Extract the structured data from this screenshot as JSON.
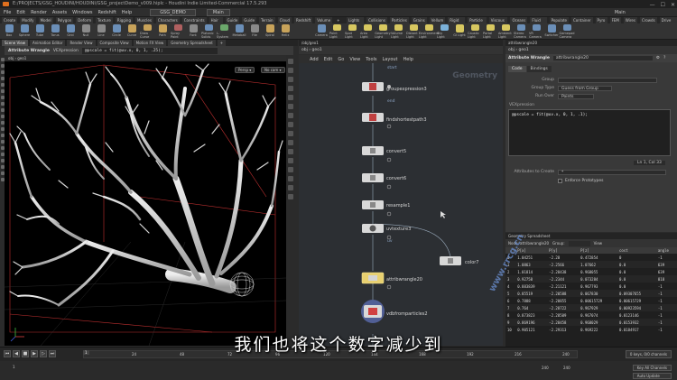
{
  "window": {
    "title": "E:/PROJECTS/GSG_HOUDINI/HOUDINI/GSG_projectDemo_v009.hiplc - Houdini Indie Limited-Commercial 17.5.293",
    "controls": [
      "—",
      "☐",
      "✕"
    ]
  },
  "menubar": {
    "items": [
      "File",
      "Edit",
      "Render",
      "Assets",
      "Windows",
      "Redshift",
      "Help"
    ],
    "desktop": "GSG_DEMO",
    "build": "Main",
    "right_label": "Main"
  },
  "shelf_tabs": [
    "Create",
    "Modify",
    "Model",
    "Polygon",
    "Deform",
    "Texture",
    "Rigging",
    "Muscles",
    "Characters",
    "Constraints",
    "Hair Utils",
    "Guide Pr",
    "Guide Br",
    "Terrain FX",
    "Cloud FX",
    "Redshift",
    "Volume",
    "+",
    "Lights and C",
    "Collisions",
    "Particles",
    "Grains",
    "Vellum",
    "Rigid Bodies",
    "Particle Fluids",
    "Viscous Fluids",
    "Oceans",
    "Fluid Contai",
    "Populate Con",
    "Container Tools",
    "Pyro FX",
    "FEM",
    "Wires",
    "Crowds",
    "Drive Simula"
  ],
  "shelf_tools_left": [
    {
      "label": "Box",
      "color": "#6b8fb8"
    },
    {
      "label": "Sphere",
      "color": "#6b8fb8"
    },
    {
      "label": "Tube",
      "color": "#6b8fb8"
    },
    {
      "label": "Torus",
      "color": "#6b8fb8"
    },
    {
      "label": "Grid",
      "color": "#6b8fb8"
    },
    {
      "label": "Null",
      "color": "#8a8a8a"
    },
    {
      "label": "Line",
      "color": "#8a8a8a"
    },
    {
      "label": "Circle",
      "color": "#6b8fb8"
    },
    {
      "label": "Curve",
      "color": "#c8a35a"
    },
    {
      "label": "Draw Curve",
      "color": "#c8a35a"
    },
    {
      "label": "Path",
      "color": "#c8a35a"
    },
    {
      "label": "Spray Paint",
      "color": "#b06060"
    },
    {
      "label": "Font",
      "color": "#8a8a8a"
    },
    {
      "label": "Platonic Solids",
      "color": "#6b8fb8"
    },
    {
      "label": "L-System",
      "color": "#6ba86b"
    },
    {
      "label": "Metaball",
      "color": "#6b8fb8"
    },
    {
      "label": "File",
      "color": "#8a8a8a"
    },
    {
      "label": "Spiral",
      "color": "#c8a35a"
    },
    {
      "label": "Helix",
      "color": "#c8a35a"
    }
  ],
  "shelf_tools_right": [
    {
      "label": "Camera",
      "color": "#6b8fb8"
    },
    {
      "label": "Point Light",
      "color": "#d8c860"
    },
    {
      "label": "Spot Light",
      "color": "#d8c860"
    },
    {
      "label": "Area Light",
      "color": "#d8c860"
    },
    {
      "label": "Geometry Light",
      "color": "#d8c860"
    },
    {
      "label": "Volume Light",
      "color": "#d8c860"
    },
    {
      "label": "Distant Light",
      "color": "#d8c860"
    },
    {
      "label": "Environment Light",
      "color": "#d8c860"
    },
    {
      "label": "Sky Light",
      "color": "#7ab0d8"
    },
    {
      "label": "GI Light",
      "color": "#d8c860"
    },
    {
      "label": "Caustic Light",
      "color": "#d8c860"
    },
    {
      "label": "Portal Light",
      "color": "#d8c860"
    },
    {
      "label": "Ambient Light",
      "color": "#d8c860"
    },
    {
      "label": "Stereo Camera",
      "color": "#6b8fb8"
    },
    {
      "label": "VR Camera",
      "color": "#6b8fb8"
    },
    {
      "label": "Switcher",
      "color": "#6b8fb8"
    },
    {
      "label": "Gamepad Camera",
      "color": "#6b8fb8"
    }
  ],
  "viewport_tabs": [
    "Scene View",
    "Animation Editor",
    "Render View",
    "Composite View",
    "Motion FX View",
    "Geometry Spreadsheet",
    "+"
  ],
  "viewport": {
    "node_type": "Attribute Wrangle",
    "lang": "VEXpression",
    "expression": "@pscale = fit(@uv.x, 0, 1, .25);",
    "path": [
      "obj",
      "geo1"
    ],
    "persp_label": "Persp ▾",
    "cam_label": "No cam ▾"
  },
  "network": {
    "tabs": "/obj/geo1",
    "path": [
      "obj",
      "geo1"
    ],
    "menu": [
      "Add",
      "Edit",
      "Go",
      "View",
      "Tools",
      "Layout",
      "Help"
    ],
    "context_label": "Geometry",
    "nodes": [
      {
        "name": "groupexpression3",
        "type": "red"
      },
      {
        "name": "findshortestpath3",
        "type": "red"
      },
      {
        "name": "convert5",
        "type": "plain"
      },
      {
        "name": "convert6",
        "type": "plain"
      },
      {
        "name": "resample1",
        "type": "plain"
      },
      {
        "name": "uvtexture3",
        "type": "plain"
      },
      {
        "name": "color7",
        "type": "plain"
      },
      {
        "name": "attribwrangle20",
        "type": "yellow"
      },
      {
        "name": "vdbfromparticles2",
        "type": "vdb"
      }
    ],
    "wire_labels": {
      "start": "start",
      "end": "end",
      "uv": "uv"
    }
  },
  "params": {
    "tabs": "attribwrangle20",
    "path": [
      "obj",
      "geo1"
    ],
    "header_type": "Attribute Wrangle",
    "header_name": "attribwrangle20",
    "subtabs": [
      "Code",
      "Bindings"
    ],
    "group_label": "Group",
    "group_value": "",
    "group_type_label": "Group Type",
    "group_type_value": "Guess from Group",
    "run_over_label": "Run Over",
    "run_over_value": "Points",
    "vex_label": "VEXpression",
    "vex_code": "@pscale = fit(@uv.x, 0, 1, .1);",
    "cursor_pos": "Ln 1, Col 33",
    "attrs_label": "Attributes to Create",
    "attrs_value": "*",
    "enforce_label": "Enforce Prototypes"
  },
  "spreadsheet": {
    "tabs": "Geometry Spreadsheet",
    "path": [
      "obj",
      "geo1"
    ],
    "node_label": "Node: attribwrangle20",
    "group_label": "Group:",
    "view_label": "View",
    "columns": [
      "",
      "P[x]",
      "P[y]",
      "P[z]",
      "cost",
      "angle"
    ],
    "rows": [
      [
        "0",
        "1.04251",
        "-2.28",
        "0.472854",
        "0",
        "-1"
      ],
      [
        "1",
        "1.0863",
        "-2.2566",
        "1.07662",
        "0.0",
        "639"
      ],
      [
        "2",
        "1.01814",
        "-2.28438",
        "0.968055",
        "0.0",
        "639"
      ],
      [
        "3",
        "0.92758",
        "-2.2344",
        "0.073284",
        "0.0",
        "818"
      ],
      [
        "4",
        "0.883839",
        "-2.21121",
        "0.967793",
        "0.0",
        "-1"
      ],
      [
        "5",
        "0.85519",
        "-2.20588",
        "0.067830",
        "0.09307655",
        "-1"
      ],
      [
        "6",
        "0.7888",
        "-2.20855",
        "0.00615729",
        "0.00615729",
        "-1"
      ],
      [
        "7",
        "0.764",
        "-2.28722",
        "0.967929",
        "0.00923594",
        "-1"
      ],
      [
        "8",
        "0.873823",
        "-2.28509",
        "0.967074",
        "0.0123146",
        "-1"
      ],
      [
        "9",
        "0.869196",
        "-2.28458",
        "0.968029",
        "0.0153932",
        "-1"
      ],
      [
        "10",
        "0.905121",
        "-2.29313",
        "0.969222",
        "0.0184917",
        "-1"
      ]
    ]
  },
  "timeline": {
    "frame": "1",
    "ticks": [
      "24",
      "48",
      "72",
      "96",
      "120",
      "144",
      "168",
      "192",
      "216",
      "240"
    ],
    "start": "1",
    "end": "240",
    "end2": "240",
    "keys_label": "0 keys, 0/0 channels",
    "key_all_label": "Key All Channels",
    "auto_update": "Auto Update"
  },
  "subtitle": "我们也将这个数字减少到",
  "watermark": "www.rrcg.cn"
}
